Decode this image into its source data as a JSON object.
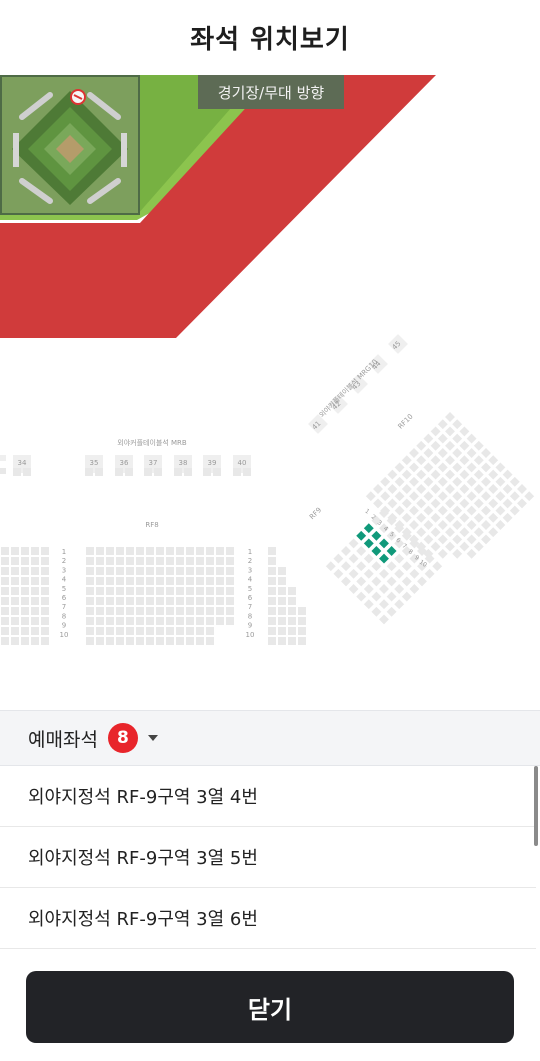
{
  "header": {
    "title": "좌석 위치보기"
  },
  "map": {
    "direction_label": "경기장/무대 방향",
    "section_labels": {
      "top_row": "외야커플테이블석 MRB",
      "right_top": "외야커플테이블석 MRG10",
      "rf8": "RF8",
      "rf9": "RF9",
      "rf10": "RF10"
    },
    "table_numbers": [
      "34",
      "35",
      "36",
      "37",
      "38",
      "39",
      "40"
    ],
    "diagonal_numbers": [
      "41",
      "42",
      "43",
      "44",
      "45"
    ],
    "row_numbers": [
      "1",
      "2",
      "3",
      "4",
      "5",
      "6",
      "7",
      "8",
      "9",
      "10"
    ],
    "colors": {
      "field_green": "#8cc44e",
      "dark_green": "#6aa33a",
      "red_zone": "#d03b3b",
      "seat": "#e8e8e8",
      "selected_seat": "#10997a"
    }
  },
  "booked": {
    "label": "예매좌석",
    "count": "8"
  },
  "seats": [
    "외야지정석 RF-9구역 3열 4번",
    "외야지정석 RF-9구역 3열 5번",
    "외야지정석 RF-9구역 3열 6번"
  ],
  "footer": {
    "close_label": "닫기"
  }
}
